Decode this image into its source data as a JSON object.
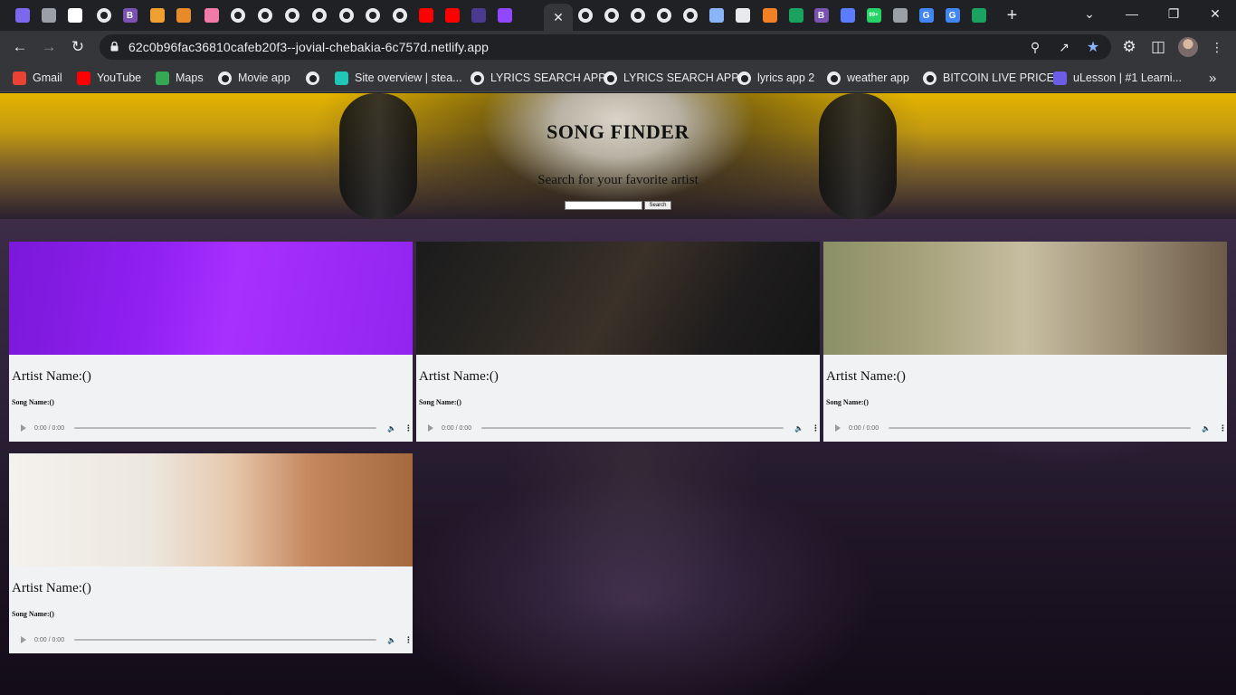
{
  "browser": {
    "tabs": [
      {
        "icon": "mail-icon",
        "color": "#7b68ee"
      },
      {
        "icon": "grid-icon",
        "color": "#9aa0a6"
      },
      {
        "icon": "page-icon",
        "color": "#ffffff"
      },
      {
        "icon": "globe-icon"
      },
      {
        "icon": "bootstrap-icon",
        "color": "#7952b3",
        "text": "B"
      },
      {
        "icon": "triangle-icon",
        "color": "#f0a030"
      },
      {
        "icon": "app-icon",
        "color": "#e88a2a"
      },
      {
        "icon": "ghost-icon",
        "color": "#f07aa8"
      },
      {
        "icon": "globe-icon"
      },
      {
        "icon": "globe-icon"
      },
      {
        "icon": "globe-icon"
      },
      {
        "icon": "globe-icon"
      },
      {
        "icon": "globe-icon"
      },
      {
        "icon": "globe-icon"
      },
      {
        "icon": "globe-icon"
      },
      {
        "icon": "youtube-icon",
        "color": "#ff0000"
      },
      {
        "icon": "youtube-icon",
        "color": "#ff0000"
      },
      {
        "icon": "coolors-icon",
        "color": "#4b3a8f"
      },
      {
        "icon": "m-icon",
        "color": "#9146ff"
      },
      {
        "icon": "close-icon",
        "active": true
      },
      {
        "icon": "globe-icon"
      },
      {
        "icon": "globe-icon"
      },
      {
        "icon": "globe-icon"
      },
      {
        "icon": "globe-icon"
      },
      {
        "icon": "globe-icon"
      },
      {
        "icon": "lambda-icon",
        "color": "#8ab4f8"
      },
      {
        "icon": "chrome-icon",
        "color": "#e8eaed"
      },
      {
        "icon": "stack-icon",
        "color": "#f48024"
      },
      {
        "icon": "w-icon",
        "color": "#1aa260"
      },
      {
        "icon": "bootstrap-icon",
        "color": "#7952b3",
        "text": "B"
      },
      {
        "icon": "link-icon",
        "color": "#5b7cff"
      },
      {
        "icon": "whatsapp-icon",
        "color": "#25d366",
        "text": "99+"
      },
      {
        "icon": "layers-icon",
        "color": "#9aa0a6"
      },
      {
        "icon": "google-icon",
        "color": "#4285f4",
        "text": "G"
      },
      {
        "icon": "google-icon",
        "color": "#4285f4",
        "text": "G"
      },
      {
        "icon": "w-icon",
        "color": "#1aa260"
      }
    ],
    "new_tab_label": "+",
    "url": "62c0b96fac36810cafeb20f3--jovial-chebakia-6c757d.netlify.app",
    "bookmarks": [
      {
        "label": "Gmail",
        "icon": "gmail-icon",
        "color": "#ea4335"
      },
      {
        "label": "YouTube",
        "icon": "youtube-icon",
        "color": "#ff0000"
      },
      {
        "label": "Maps",
        "icon": "maps-icon",
        "color": "#34a853"
      },
      {
        "label": "Movie app",
        "icon": "globe-icon"
      },
      {
        "label": "",
        "icon": "globe-icon"
      },
      {
        "label": "Site overview | stea...",
        "icon": "netlify-icon",
        "color": "#20c6b7"
      },
      {
        "label": "LYRICS SEARCH APP",
        "icon": "globe-icon"
      },
      {
        "label": "LYRICS SEARCH APP",
        "icon": "globe-icon"
      },
      {
        "label": "lyrics app 2",
        "icon": "globe-icon"
      },
      {
        "label": "weather app",
        "icon": "globe-icon"
      },
      {
        "label": "BITCOIN LIVE PRICE",
        "icon": "globe-icon"
      },
      {
        "label": "uLesson | #1 Learni...",
        "icon": "ulesson-icon",
        "color": "#6c5ce7"
      }
    ]
  },
  "site": {
    "title": "SONG FINDER",
    "subtitle": "Search for your favorite artist",
    "search_button": "Search",
    "search_placeholder": ""
  },
  "cards": [
    {
      "artist": "Artist Name:()",
      "song": "Song Name:()",
      "time": "0:00 / 0:00",
      "scene": "purple"
    },
    {
      "artist": "Artist Name:()",
      "song": "Song Name:()",
      "time": "0:00 / 0:00",
      "scene": "guitar"
    },
    {
      "artist": "Artist Name:()",
      "song": "Song Name:()",
      "time": "0:00 / 0:00",
      "scene": "park"
    },
    {
      "artist": "Artist Name:()",
      "song": "Song Name:()",
      "time": "0:00 / 0:00",
      "scene": "white"
    }
  ]
}
